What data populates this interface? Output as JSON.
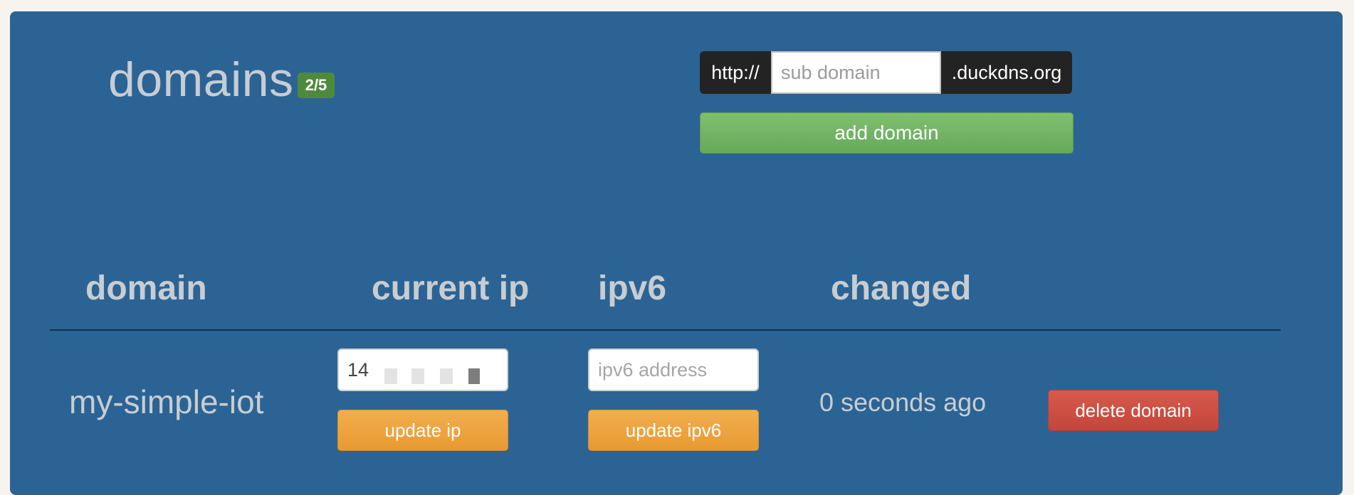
{
  "page": {
    "title": "domains",
    "badge": "2/5"
  },
  "add_form": {
    "prefix": "http://",
    "subdomain_placeholder": "sub domain",
    "suffix": ".duckdns.org",
    "add_label": "add domain"
  },
  "table": {
    "columns": [
      "domain",
      "current ip",
      "ipv6",
      "changed"
    ],
    "rows": [
      {
        "domain": "my-simple-iot",
        "current_ip_visible": "14",
        "ipv6_placeholder": "ipv6 address",
        "update_ip_label": "update ip",
        "update_ipv6_label": "update ipv6",
        "changed": "0 seconds ago",
        "delete_label": "delete domain"
      }
    ]
  },
  "colors": {
    "panel": "#2b6494",
    "badge": "#4e8a3d",
    "add_button": "#6ead5f",
    "update_button": "#eca33f",
    "delete_button": "#cc5044"
  }
}
